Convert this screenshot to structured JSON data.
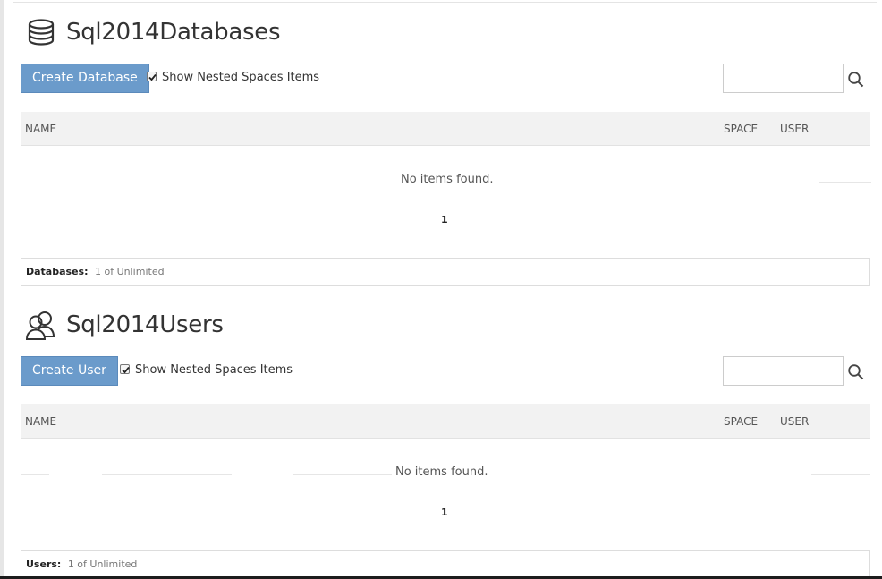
{
  "databases": {
    "title": "Sql2014Databases",
    "icon": "database-icon",
    "create_label": "Create Database",
    "nested_label": "Show Nested Spaces Items",
    "nested_checked": true,
    "search": {
      "value": "",
      "placeholder": ""
    },
    "columns": {
      "name": "NAME",
      "space": "SPACE",
      "user": "USER"
    },
    "empty_message": "No items found.",
    "pager": "1",
    "quota_label": "Databases:",
    "quota_value": "1 of Unlimited"
  },
  "users": {
    "title": "Sql2014Users",
    "icon": "users-icon",
    "create_label": "Create User",
    "nested_label": "Show Nested Spaces Items",
    "nested_checked": true,
    "search": {
      "value": "",
      "placeholder": ""
    },
    "columns": {
      "name": "NAME",
      "space": "SPACE",
      "user": "USER"
    },
    "empty_message": "No items found.",
    "pager": "1",
    "quota_label": "Users:",
    "quota_value": "1 of Unlimited"
  },
  "colors": {
    "button_bg": "#6b9bcb",
    "header_bg": "#f2f2f2",
    "text": "#333333"
  }
}
